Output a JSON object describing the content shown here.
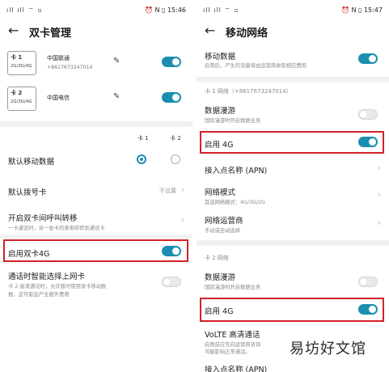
{
  "left": {
    "status": {
      "left": "ıll ıll ⌔ ▫",
      "right": "⏰ N ▯ 15:46"
    },
    "title": "双卡管理",
    "cards": [
      {
        "name": "卡 1",
        "modes": "2G/3G/4G",
        "carrier": "中国联通",
        "phone": "+8617673247014",
        "enabled": true
      },
      {
        "name": "卡 2",
        "modes": "2G/3G/4G",
        "carrier": "中国电信",
        "phone": "",
        "enabled": true
      }
    ],
    "col_card1": "卡 1",
    "col_card2": "卡 2",
    "default_data": {
      "label": "默认移动数据",
      "selected": "card1"
    },
    "default_dial": {
      "label": "默认拨号卡",
      "value": "不设置"
    },
    "call_forward": {
      "label": "开启双卡间呼叫转移",
      "sub": "一卡通话时，另一张卡的来电呼转到通话卡"
    },
    "enable_4g": {
      "label": "启用双卡4G",
      "enabled": true
    },
    "smart_switch": {
      "label": "通话时智能选择上网卡",
      "sub1": "卡 2 高清通话时，允许暂时使用该卡移动数",
      "sub2": "据，这可能会产生额外费用",
      "enabled": false
    }
  },
  "right": {
    "status": {
      "left": "ıll ıll ⌔ ▫",
      "right": "⏰ N ▯ 15:47"
    },
    "title": "移动网络",
    "mobile_data": {
      "label": "移动数据",
      "sub": "启用后，产生的流量将由运营商收取相应费用",
      "enabled": true
    },
    "card1_header": "卡 1 网络（+8617673247014）",
    "roaming1": {
      "label": "数据漫游",
      "sub": "国际漫游时开启数据业务",
      "enabled": false
    },
    "enable_4g_1": {
      "label": "启用 4G",
      "enabled": true
    },
    "apn": {
      "label": "接入点名称 (APN)"
    },
    "network_mode": {
      "label": "网络模式",
      "sub": "首选网络模式：4G/3G/2G"
    },
    "operator": {
      "label": "网络运营商",
      "sub": "手动或自动选择"
    },
    "card2_header": "卡 2 网络",
    "roaming2": {
      "label": "数据漫游",
      "sub": "国际漫游时开启数据业务",
      "enabled": false
    },
    "enable_4g_2": {
      "label": "启用 4G",
      "enabled": true
    },
    "volte": {
      "label": "VoLTE 高清通话",
      "sub1": "启用前应先向运营商咨询",
      "sub2": "可能影响正常通话。"
    },
    "apn2": {
      "label": "接入点名称 (APN)"
    }
  },
  "watermark": "易坊好文馆",
  "colors": {
    "accent": "#1a8fb0",
    "highlight": "#d32128",
    "divider": "#f1f1f1"
  }
}
